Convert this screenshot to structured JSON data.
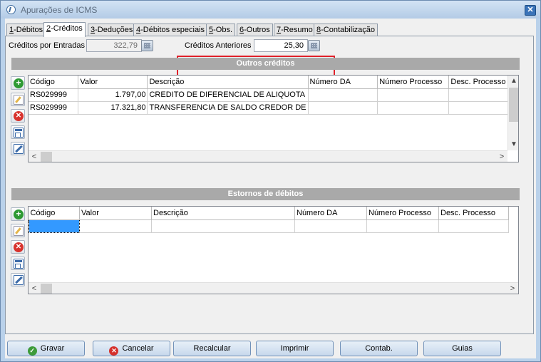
{
  "window": {
    "title": "Apurações de ICMS",
    "close_label": "✕"
  },
  "tabs": [
    {
      "key": "1",
      "label": "-Débitos"
    },
    {
      "key": "2",
      "label": "-Créditos"
    },
    {
      "key": "3",
      "label": "-Deduções"
    },
    {
      "key": "4",
      "label": "-Débitos especiais"
    },
    {
      "key": "5",
      "label": "-Obs."
    },
    {
      "key": "6",
      "label": "-Outros"
    },
    {
      "key": "7",
      "label": "-Resumo"
    },
    {
      "key": "8",
      "label": "-Contabilização"
    }
  ],
  "active_tab": "2-Créditos",
  "creditos_entradas": {
    "label": "Créditos por Entradas",
    "value": "322,79"
  },
  "creditos_anteriores": {
    "label": "Créditos Anteriores",
    "value": "25,30"
  },
  "outros_creditos": {
    "title": "Outros créditos",
    "columns": [
      "Código",
      "Valor",
      "Descrição",
      "Número DA",
      "Número Processo",
      "Desc. Processo"
    ],
    "rows": [
      [
        "RS029999",
        "1.797,00",
        "CREDITO DE DIFERENCIAL DE ALIQUOTA",
        "",
        "",
        ""
      ],
      [
        "RS029999",
        "17.321,80",
        "TRANSFERENCIA DE SALDO CREDOR DE",
        "",
        "",
        ""
      ]
    ]
  },
  "estornos_debitos": {
    "title": "Estornos de débitos",
    "columns": [
      "Código",
      "Valor",
      "Descrição",
      "Número DA",
      "Número Processo",
      "Desc. Processo"
    ]
  },
  "scroll": {
    "up": "▲",
    "down": "▼",
    "left": "<",
    "right": ">"
  },
  "side_icons": {
    "add": "+",
    "delete": "✕"
  },
  "buttons": {
    "gravar": "Gravar",
    "cancelar": "Cancelar",
    "recalcular": "Recalcular",
    "imprimir": "Imprimir",
    "contab": "Contab.",
    "guias": "Guias"
  },
  "button_icons": {
    "check": "✓",
    "x": "✕"
  }
}
